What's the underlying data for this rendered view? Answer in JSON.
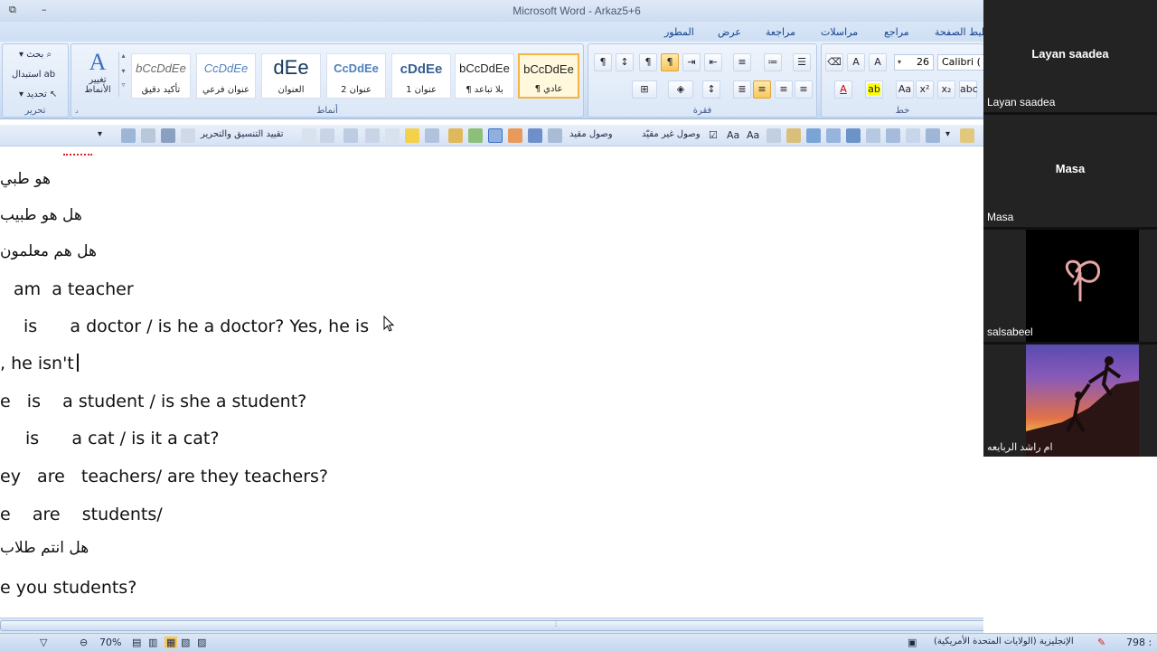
{
  "window": {
    "title": "Microsoft Word - Arkaz5+6"
  },
  "tabs": [
    "المطور",
    "عرض",
    "مراجعة",
    "مراسلات",
    "مراجع",
    "تخطيط الصفحة"
  ],
  "ribbon": {
    "editing": {
      "label": "تحرير",
      "find": "بحث",
      "replace": "استبدال",
      "select": "تحديد"
    },
    "change_styles": "تغيير الأنماط",
    "styles": {
      "label": "أنماط",
      "items": [
        {
          "preview": "bCcDdEe",
          "name": "تأكيد دقيق"
        },
        {
          "preview": "CcDdEe",
          "name": "عنوان فرعي"
        },
        {
          "preview": "dEe",
          "name": "العنوان"
        },
        {
          "preview": "CcDdEe",
          "name": "عنوان 2"
        },
        {
          "preview": "cDdEe",
          "name": "عنوان 1"
        },
        {
          "preview": "bCcDdEe",
          "name": "¶ بلا تباعد"
        },
        {
          "preview": "bCcDdEe",
          "name": "¶ عادي"
        }
      ],
      "selected_index": 6
    },
    "paragraph": {
      "label": "فقرة"
    },
    "font": {
      "label": "خط",
      "size": "26",
      "family": "Calibri ("
    }
  },
  "qat": {
    "format_restrict": "تقييد التنسيق والتحرير",
    "restricted_access": "وصول مقيد",
    "unrestricted_access": "وصول غير مقيّد"
  },
  "document": {
    "lines": [
      "هو طبي",
      "هل هو طبيب",
      "هل هم معلمون",
      "am  a teacher",
      "is      a doctor / is he a doctor? Yes, he is",
      ", he isn't",
      "e   is    a student / is she a student?",
      "is      a cat / is it a cat?",
      "ey   are   teachers/ are they teachers?",
      "e    are    students/",
      "هل انتم طلاب",
      "e you students?"
    ]
  },
  "statusbar": {
    "zoom": "70%",
    "language": "الإنجليزية (الولايات المتحدة الأمريكية)",
    "words": "798 :"
  },
  "participants": [
    {
      "display": "Layan saadea",
      "label": "Layan saadea"
    },
    {
      "display": "Masa",
      "label": "Masa"
    },
    {
      "display": "",
      "label": "salsabeel"
    },
    {
      "display": "",
      "label": "ام راشد الربايعه"
    }
  ],
  "colors": {
    "ribbon_bg": "#d3e2f5",
    "accent": "#15428b",
    "selected_style": "#f2b544"
  }
}
